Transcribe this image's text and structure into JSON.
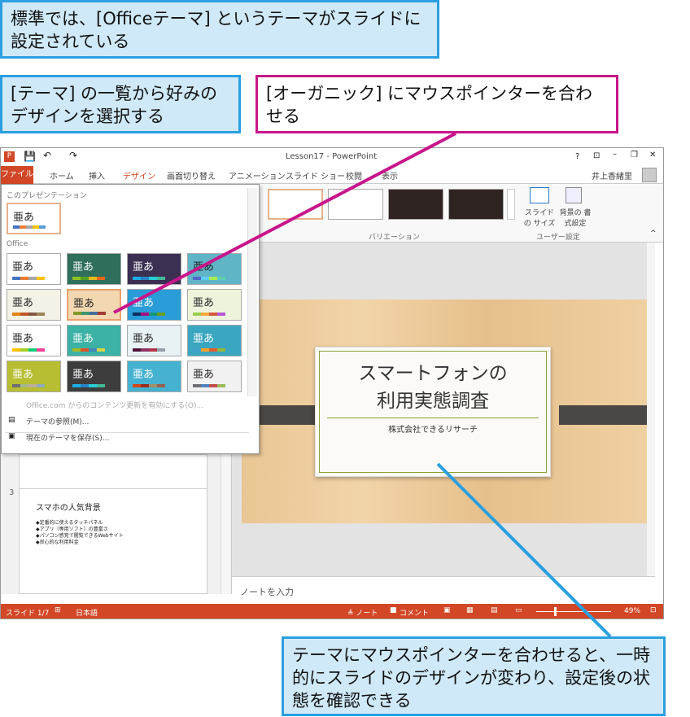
{
  "callouts": {
    "top": "標準では、[Officeテーマ] というテーマがスライドに設定されている",
    "left": "[テーマ] の一覧から好みのデザインを選択する",
    "pink": "[オーガニック] にマウスポインターを合わせる",
    "bottom": "テーマにマウスポインターを合わせると、一時的にスライドのデザインが変わり、設定後の状態を確認できる"
  },
  "window": {
    "title": "Lesson17 - PowerPoint",
    "user": "井上香緒里",
    "help": "?",
    "tabs": [
      "ファイル",
      "ホーム",
      "挿入",
      "デザイン",
      "画面切り替え",
      "アニメーション",
      "スライド ショー",
      "校閲",
      "表示"
    ]
  },
  "ribbon": {
    "variation_label": "バリエーション",
    "user_group_label": "ユーザー設定",
    "slide_size": "スライドの サイズ",
    "bg_format": "背景の 書式設定"
  },
  "gallery": {
    "this_presentation": "このプレゼンテーション",
    "office": "Office",
    "sample_text": "亜あ",
    "office_com": "Office.com からのコンテンツ更新を有効にする(O)...",
    "browse": "テーマの参照(M)...",
    "save": "現在のテーマを保存(S)..."
  },
  "slide_pane": {
    "slide_number": "3",
    "title": "スマホの人気背景",
    "bullets": [
      "◆定番的に使えるタッチパネル",
      "◆アプリ（専用ソフト）の豊富さ",
      "◆パソコン感覚で閲覧できるWebサイト",
      "◆良心的な利用料金"
    ]
  },
  "slide": {
    "title_line1": "スマートフォンの",
    "title_line2": "利用実態調査",
    "subtitle": "株式会社できるリサーチ"
  },
  "notes_placeholder": "ノートを入力",
  "statusbar": {
    "slide": "スライド 1/7",
    "lang": "日本語",
    "notes": "≜ ノート",
    "comments": "コメント",
    "zoom": "49%"
  },
  "colors": {
    "accent": "#d24726",
    "callout_blue": "#2b9fe0",
    "callout_pink": "#c8168a"
  }
}
